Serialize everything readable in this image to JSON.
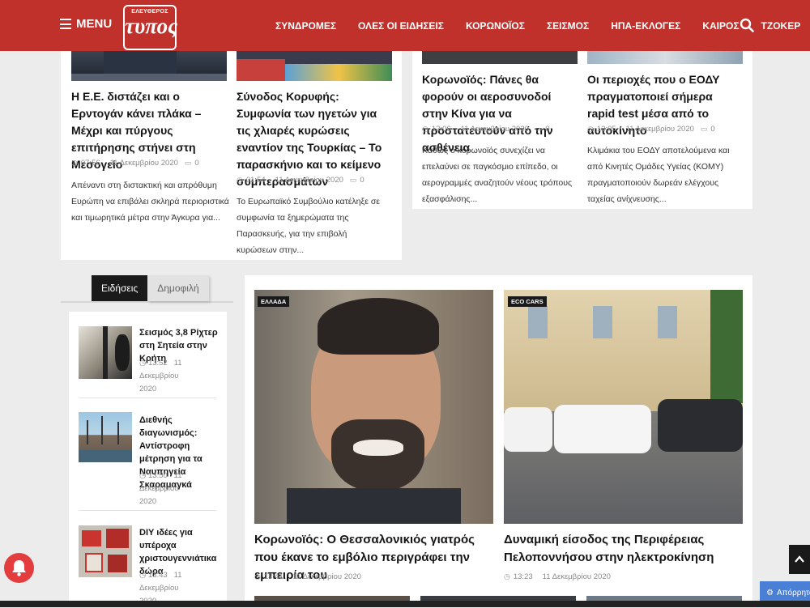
{
  "header": {
    "menu_label": "MENU",
    "logo_small": "ΕΛΕΥΘΕΡΟΣ",
    "logo_big": "τυπος",
    "nav": [
      "ΣΥΝΔΡΟΜΕΣ",
      "ΟΛΕΣ ΟΙ ΕΙΔΗΣΕΙΣ",
      "ΚΟΡΩΝΟΪΟΣ",
      "ΣΕΙΣΜΟΣ",
      "ΗΠΑ-ΕΚΛΟΓΕΣ",
      "ΚΑΙΡΟΣ",
      "ΤΖΟΚΕΡ"
    ]
  },
  "top_articles": [
    {
      "title": "Η Ε.Ε. διστάζει και ο Ερντογάν κάνει πλάκα – Μέχρι και πύργους επιτήρησης στήνει στη Μεσογείο",
      "time": "07:56",
      "date": "11 Δεκεμβρίου 2020",
      "comments": "0",
      "excerpt": "Απέναντι στη διστακτική και απρόθυμη Ευρώπη να επιβάλει σκληρά περιοριστικά και τιμωρητικά μέτρα στην Άγκυρα για..."
    },
    {
      "title": "Σύνοδος Κορυφής: Συμφωνία των ηγετών για τις χλιαρές κυρώσεις εναντίον της Τουρκίας – Το παρασκήνιο και το κείμενο συμπερασμάτων",
      "time": "01:54",
      "date": "11 Δεκεμβρίου 2020",
      "comments": "0",
      "excerpt": "Το Ευρωπαϊκό Συμβούλιο κατέληξε σε συμφωνία τα ξημερώματα της Παρασκευής, για την επιβολή κυρώσεων στην..."
    },
    {
      "title": "Κορωνοϊός: Πάνες θα φορούν οι αεροσυνοδοί στην Κίνα για να προστατευτούν από την ασθένεια",
      "time": "12:06",
      "date": "11 Δεκεμβρίου 2020",
      "comments": "0",
      "excerpt": "Καθώς ο κορωνοϊός συνεχίζει να επελαύνει σε παγκόσμιο επίπεδο, οι αερογραμμές αναζητούν νέους τρόπους εξασφάλισης..."
    },
    {
      "title": "Οι περιοχές που ο ΕΟΔΥ πραγματοποιεί σήμερα rapid test μέσα από το αυτοκίνητο",
      "time": "12:05",
      "date": "11 Δεκεμβρίου 2020",
      "comments": "0",
      "excerpt": "Κλιμάκια του ΕΟΔΥ αποτελούμενα και από Κινητές Ομάδες Υγείας (ΚΟΜΥ) πραγματοποιούν δωρεάν ελέγχους ταχείας ανίχνευσης..."
    }
  ],
  "sidebar": {
    "tabs": [
      "Ειδήσεις",
      "Δημοφιλή"
    ],
    "items": [
      {
        "title": "Σεισμός 3,8 Ρίχτερ στη Σητεία στην Κρήτη",
        "time": "13:52",
        "date": "11 Δεκεμβρίου",
        "year": "2020"
      },
      {
        "title": "Διεθνής διαγωνισμός: Αντίστροφη μέτρηση για τα Ναυπηγεία Σκαραμαγκά",
        "time": "13:50",
        "date": "11 Δεκεμβρίου",
        "year": "2020"
      },
      {
        "title": "DIY ιδέες για υπέροχα χριστουγεννιάτικα δώρα",
        "time": "13:43",
        "date": "11 Δεκεμβρίου",
        "year": "2020"
      }
    ]
  },
  "featured": [
    {
      "badge": "ΕΛΛΑΔΑ",
      "title": "Κορωνοϊός: Ο Θεσσαλονικιός γιατρός που έκανε το εμβόλιο περιγράφει την εμπειρία του",
      "time": "13:41",
      "date": "11 Δεκεμβρίου 2020"
    },
    {
      "badge": "ECO CARS",
      "title": "Δυναμική είσοδος της Περιφέρειας Πελοποννήσου στην ηλεκτροκίνηση",
      "time": "13:23",
      "date": "11 Δεκεμβρίου 2020"
    }
  ],
  "consent_label": "Απόρρητο",
  "colors": {
    "brand_red": "#c0312b",
    "consent_blue": "#4a7fd6"
  }
}
